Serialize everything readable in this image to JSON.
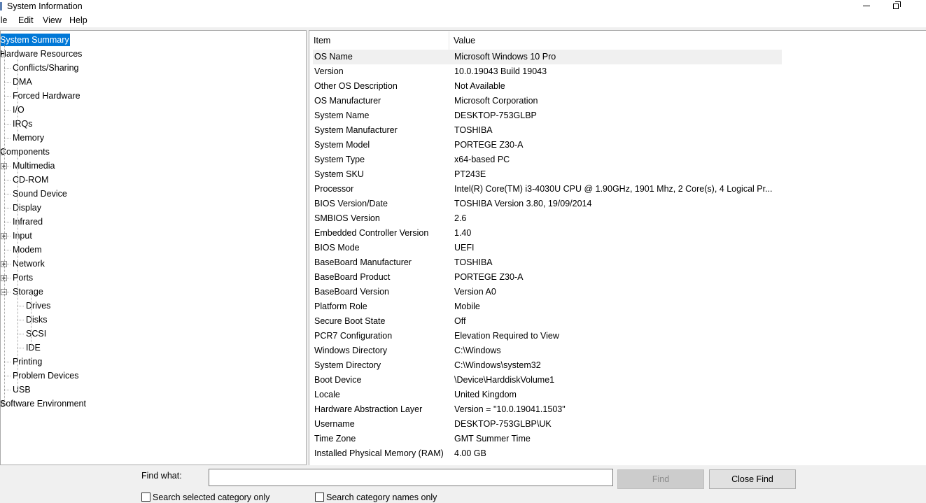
{
  "window": {
    "title": "System Information"
  },
  "menu": [
    "ile",
    "Edit",
    "View",
    "Help"
  ],
  "tree": [
    {
      "label": "System Summary",
      "level": 0,
      "selected": true,
      "expander": null
    },
    {
      "label": "Hardware Resources",
      "level": 0,
      "expander": "minus"
    },
    {
      "label": "Conflicts/Sharing",
      "level": 1,
      "expander": null
    },
    {
      "label": "DMA",
      "level": 1,
      "expander": null
    },
    {
      "label": "Forced Hardware",
      "level": 1,
      "expander": null
    },
    {
      "label": "I/O",
      "level": 1,
      "expander": null
    },
    {
      "label": "IRQs",
      "level": 1,
      "expander": null
    },
    {
      "label": "Memory",
      "level": 1,
      "expander": null
    },
    {
      "label": "Components",
      "level": 0,
      "expander": "minus"
    },
    {
      "label": "Multimedia",
      "level": 1,
      "expander": "plus"
    },
    {
      "label": "CD-ROM",
      "level": 1,
      "expander": null
    },
    {
      "label": "Sound Device",
      "level": 1,
      "expander": null
    },
    {
      "label": "Display",
      "level": 1,
      "expander": null
    },
    {
      "label": "Infrared",
      "level": 1,
      "expander": null
    },
    {
      "label": "Input",
      "level": 1,
      "expander": "plus"
    },
    {
      "label": "Modem",
      "level": 1,
      "expander": null
    },
    {
      "label": "Network",
      "level": 1,
      "expander": "plus"
    },
    {
      "label": "Ports",
      "level": 1,
      "expander": "plus"
    },
    {
      "label": "Storage",
      "level": 1,
      "expander": "minus"
    },
    {
      "label": "Drives",
      "level": 2,
      "expander": null
    },
    {
      "label": "Disks",
      "level": 2,
      "expander": null
    },
    {
      "label": "SCSI",
      "level": 2,
      "expander": null
    },
    {
      "label": "IDE",
      "level": 2,
      "expander": null
    },
    {
      "label": "Printing",
      "level": 1,
      "expander": null
    },
    {
      "label": "Problem Devices",
      "level": 1,
      "expander": null
    },
    {
      "label": "USB",
      "level": 1,
      "expander": null
    },
    {
      "label": "Software Environment",
      "level": 0,
      "expander": "plus"
    }
  ],
  "detail": {
    "columns": [
      "Item",
      "Value"
    ],
    "rows": [
      {
        "item": "OS Name",
        "value": "Microsoft Windows 10 Pro"
      },
      {
        "item": "Version",
        "value": "10.0.19043 Build 19043"
      },
      {
        "item": "Other OS Description",
        "value": "Not Available"
      },
      {
        "item": "OS Manufacturer",
        "value": "Microsoft Corporation"
      },
      {
        "item": "System Name",
        "value": "DESKTOP-753GLBP"
      },
      {
        "item": "System Manufacturer",
        "value": "TOSHIBA"
      },
      {
        "item": "System Model",
        "value": "PORTEGE Z30-A"
      },
      {
        "item": "System Type",
        "value": "x64-based PC"
      },
      {
        "item": "System SKU",
        "value": "PT243E"
      },
      {
        "item": "Processor",
        "value": "Intel(R) Core(TM) i3-4030U CPU @ 1.90GHz, 1901 Mhz, 2 Core(s), 4 Logical Pr..."
      },
      {
        "item": "BIOS Version/Date",
        "value": "TOSHIBA Version 3.80, 19/09/2014"
      },
      {
        "item": "SMBIOS Version",
        "value": "2.6"
      },
      {
        "item": "Embedded Controller Version",
        "value": "1.40"
      },
      {
        "item": "BIOS Mode",
        "value": "UEFI"
      },
      {
        "item": "BaseBoard Manufacturer",
        "value": "TOSHIBA"
      },
      {
        "item": "BaseBoard Product",
        "value": "PORTEGE Z30-A"
      },
      {
        "item": "BaseBoard Version",
        "value": "Version A0"
      },
      {
        "item": "Platform Role",
        "value": "Mobile"
      },
      {
        "item": "Secure Boot State",
        "value": "Off"
      },
      {
        "item": "PCR7 Configuration",
        "value": "Elevation Required to View"
      },
      {
        "item": "Windows Directory",
        "value": "C:\\Windows"
      },
      {
        "item": "System Directory",
        "value": "C:\\Windows\\system32"
      },
      {
        "item": "Boot Device",
        "value": "\\Device\\HarddiskVolume1"
      },
      {
        "item": "Locale",
        "value": "United Kingdom"
      },
      {
        "item": "Hardware Abstraction Layer",
        "value": "Version = \"10.0.19041.1503\""
      },
      {
        "item": "Username",
        "value": "DESKTOP-753GLBP\\UK"
      },
      {
        "item": "Time Zone",
        "value": "GMT Summer Time"
      },
      {
        "item": "Installed Physical Memory (RAM)",
        "value": "4.00 GB"
      }
    ]
  },
  "find": {
    "label": "Find what:",
    "value": "",
    "find_button": "Find",
    "close_button": "Close Find",
    "check_selected": "Search selected category only",
    "check_names": "Search category names only"
  },
  "colors": {
    "selection": "#0078d7",
    "row_highlight": "#f0f0f0"
  }
}
